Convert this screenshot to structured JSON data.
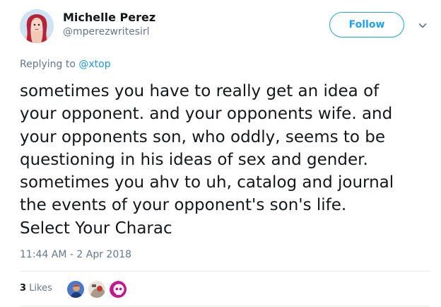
{
  "author": {
    "display_name": "Michelle Perez",
    "handle": "@mperezwritesirl"
  },
  "follow_label": "Follow",
  "reply": {
    "prefix": "Replying to",
    "mention": "@xtop"
  },
  "tweet_lines": [
    "sometimes you have to really get an idea of",
    "your opponent. and your opponents wife. and",
    "your opponents son, who oddly, seems to be",
    "questioning in his ideas of sex and gender.",
    "sometimes you ahv to uh, catalog and journal",
    "the events of your opponent's son's life.",
    "Select Your Charac"
  ],
  "timestamp": "11:44 AM - 2 Apr 2018",
  "likes": {
    "count": "3",
    "label": "Likes"
  },
  "colors": {
    "accent": "#1da1f2",
    "secondary_text": "#657786",
    "primary_text": "#14171a",
    "divider": "#e6ecf0"
  },
  "icons": [
    "chevron-down-icon"
  ]
}
